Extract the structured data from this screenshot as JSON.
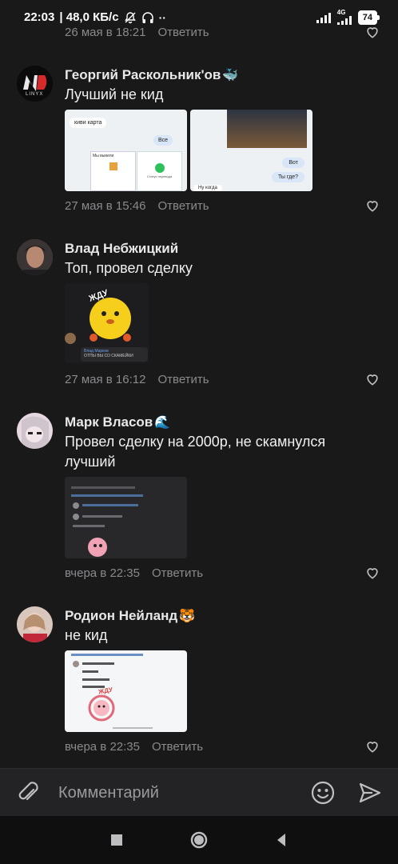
{
  "status_bar": {
    "time": "22:03",
    "speed": "| 48,0 КБ/с",
    "net_label": "4G",
    "battery": "74"
  },
  "top_comment_meta": {
    "date": "26 мая в 18:21",
    "reply": "Ответить"
  },
  "comments": [
    {
      "name": "Георгий Раскольник'ов",
      "name_emoji": "🐳",
      "text": "Лучший не кид",
      "date": "27 мая в 15:46",
      "reply": "Ответить",
      "avatar_label": "LINYX",
      "thumb1": {
        "bubble1": "киви карта",
        "bubble2": "Все",
        "card_title": "Мы вывели",
        "card_caption": "Статус перевода"
      },
      "thumb2": {
        "bubble1": "Вот",
        "bubble2": "Ты где?",
        "bubble3": "Ну когда"
      }
    },
    {
      "name": "Влад Небжицкий",
      "text": "Топ, провел сделку",
      "date": "27 мая в 16:12",
      "reply": "Ответить",
      "sticker_text": "ЖДУ",
      "quote_author": "Влад Марков",
      "quote_text": "ОТПЫ ВЫ СО СКАМЕЙКИ"
    },
    {
      "name": "Марк Власов",
      "name_emoji": "🌊",
      "text": "Провел сделку на 2000р, не скамнулся лучший",
      "date": "вчера в 22:35",
      "reply": "Ответить"
    },
    {
      "name": "Родион Нейланд",
      "name_emoji": "🐯",
      "text": "не кид",
      "date": "вчера в 22:35",
      "reply": "Ответить",
      "sticker_text": "ЖДУ"
    }
  ],
  "composer": {
    "placeholder": "Комментарий"
  },
  "colors": {
    "background": "#19191a",
    "meta": "#8a8a8c",
    "composer": "#232325"
  }
}
